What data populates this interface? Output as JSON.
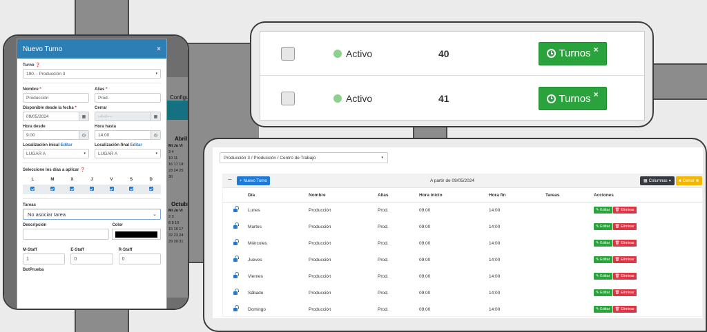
{
  "modal": {
    "title": "Nuevo Turno",
    "close": "×",
    "turno_label": "Turno",
    "turno_value": "190. - Producción 3",
    "nombre_label": "Nombre",
    "nombre_value": "Producción",
    "alias_label": "Alias",
    "alias_value": "Prod.",
    "desde_fecha_label": "Disponible desde la fecha",
    "desde_fecha_value": "09/05/2024",
    "cerrar_label": "Cerrar",
    "cerrar_placeholder": "--/--/----",
    "hora_desde_label": "Hora desde",
    "hora_desde_value": "9:00",
    "hora_hasta_label": "Hora hasta",
    "hora_hasta_value": "14:00",
    "loc_inicial_label": "Localización inical",
    "loc_final_label": "Localización final",
    "editar_link": "Editar",
    "loc_inicial_value": "LUGAR A",
    "loc_final_value": "LUGAR A",
    "dias_label": "Seleccione los días a aplicar",
    "days": [
      "L",
      "M",
      "X",
      "J",
      "V",
      "S",
      "D"
    ],
    "tareas_label": "Tareas",
    "tareas_value": "No asociar tarea",
    "descripcion_label": "Descripción",
    "color_label": "Color",
    "color_value": "#000000",
    "mstaff_label": "M-Staff",
    "estaff_label": "E-Staff",
    "rstaff_label": "R-Staff",
    "mstaff_value": "1",
    "estaff_value": "0",
    "rstaff_value": "0",
    "bottom_cut_label": "BotPrueba"
  },
  "backdrop": {
    "configura": "Configura",
    "abril": "Abril",
    "octubre": "Octubre",
    "cal_head": "Mi Ju Vi",
    "abril_rows": [
      "3 4",
      "10 11",
      "16 17 18",
      "23 24 25",
      "30"
    ],
    "octubre_rows": [
      "2 3",
      "8 9 10",
      "15 16 17",
      "22 23 24",
      "29 30 31"
    ]
  },
  "status_list": {
    "rows": [
      {
        "status": "Activo",
        "number": "40",
        "button": "Turnos",
        "x": "×"
      },
      {
        "status": "Activo",
        "number": "41",
        "button": "Turnos",
        "x": "×"
      }
    ],
    "status_color": "#8fcf8f",
    "button_color": "#2aa33c"
  },
  "horario": {
    "breadcrumb": "Producción 3 / Producción / Centro de Trabajo",
    "collapse": "−",
    "nuevo_turno": "Nuevo Turno",
    "a_partir": "A partir de 09/05/2024",
    "columnas": "Columnas",
    "cerrar": "Cerrar",
    "headers": [
      "Día",
      "Nombre",
      "Alias",
      "Hora inicio",
      "Hora fin",
      "Tareas",
      "Acciones"
    ],
    "rows": [
      {
        "dia": "Lunes",
        "nombre": "Producción",
        "alias": "Prod.",
        "inicio": "09:00",
        "fin": "14:00",
        "tareas": ""
      },
      {
        "dia": "Martes",
        "nombre": "Producción",
        "alias": "Prod.",
        "inicio": "09:00",
        "fin": "14:00",
        "tareas": ""
      },
      {
        "dia": "Miércoles",
        "nombre": "Producción",
        "alias": "Prod.",
        "inicio": "09:00",
        "fin": "14:00",
        "tareas": ""
      },
      {
        "dia": "Jueves",
        "nombre": "Producción",
        "alias": "Prod.",
        "inicio": "09:00",
        "fin": "14:00",
        "tareas": ""
      },
      {
        "dia": "Viernes",
        "nombre": "Producción",
        "alias": "Prod.",
        "inicio": "09:00",
        "fin": "14:00",
        "tareas": ""
      },
      {
        "dia": "Sábado",
        "nombre": "Producción",
        "alias": "Prod.",
        "inicio": "09:00",
        "fin": "14:00",
        "tareas": ""
      },
      {
        "dia": "Domingo",
        "nombre": "Producción",
        "alias": "Prod.",
        "inicio": "09:00",
        "fin": "14:00",
        "tareas": ""
      }
    ],
    "editar": "Editar",
    "eliminar": "Eliminar"
  }
}
